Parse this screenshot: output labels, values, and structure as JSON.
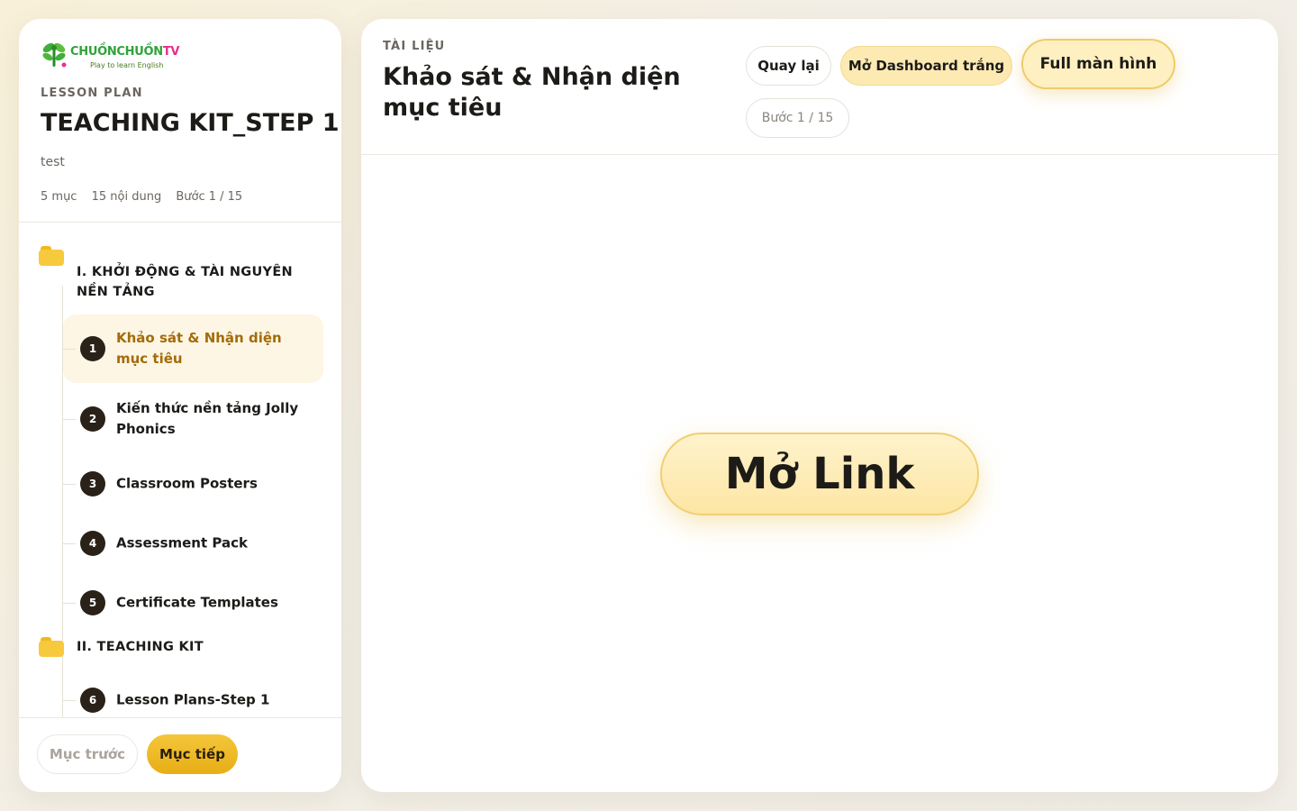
{
  "brand": {
    "logo_text_main": "CHUỒNCHUỒN",
    "logo_text_tv": "TV",
    "logo_tagline": "Play to learn English"
  },
  "lesson": {
    "label": "LESSON PLAN",
    "title": "TEACHING KIT_STEP 1",
    "subtitle": "test",
    "meta_sections": "5 mục",
    "meta_contents": "15 nội dung",
    "meta_step": "Bước 1 / 15"
  },
  "sections": [
    {
      "title": "I. KHỞI ĐỘNG & TÀI NGUYÊN NỀN TẢNG",
      "items": [
        {
          "num": "1",
          "label": "Khảo sát & Nhận diện mục tiêu",
          "active": true
        },
        {
          "num": "2",
          "label": "Kiến thức nền tảng Jolly Phonics"
        },
        {
          "num": "3",
          "label": "Classroom Posters"
        },
        {
          "num": "4",
          "label": "Assessment Pack"
        },
        {
          "num": "5",
          "label": "Certificate Templates"
        }
      ]
    },
    {
      "title": "II. TEACHING KIT",
      "items": [
        {
          "num": "6",
          "label": "Lesson Plans-Step 1"
        }
      ]
    }
  ],
  "footer": {
    "prev_label": "Mục trước",
    "next_label": "Mục tiếp"
  },
  "document": {
    "label": "TÀI LIỆU",
    "title": "Khảo sát & Nhận diện mục tiêu",
    "back_label": "Quay lại",
    "dashboard_label": "Mở Dashboard trắng",
    "fullscreen_label": "Full màn hình",
    "step_label": "Bước 1 / 15",
    "open_link_label": "Mở Link"
  },
  "colors": {
    "accent": "#f5c63a",
    "active_text": "#a36b0b",
    "active_bg": "#fdf6e4",
    "badge_bg": "#2a2118"
  }
}
